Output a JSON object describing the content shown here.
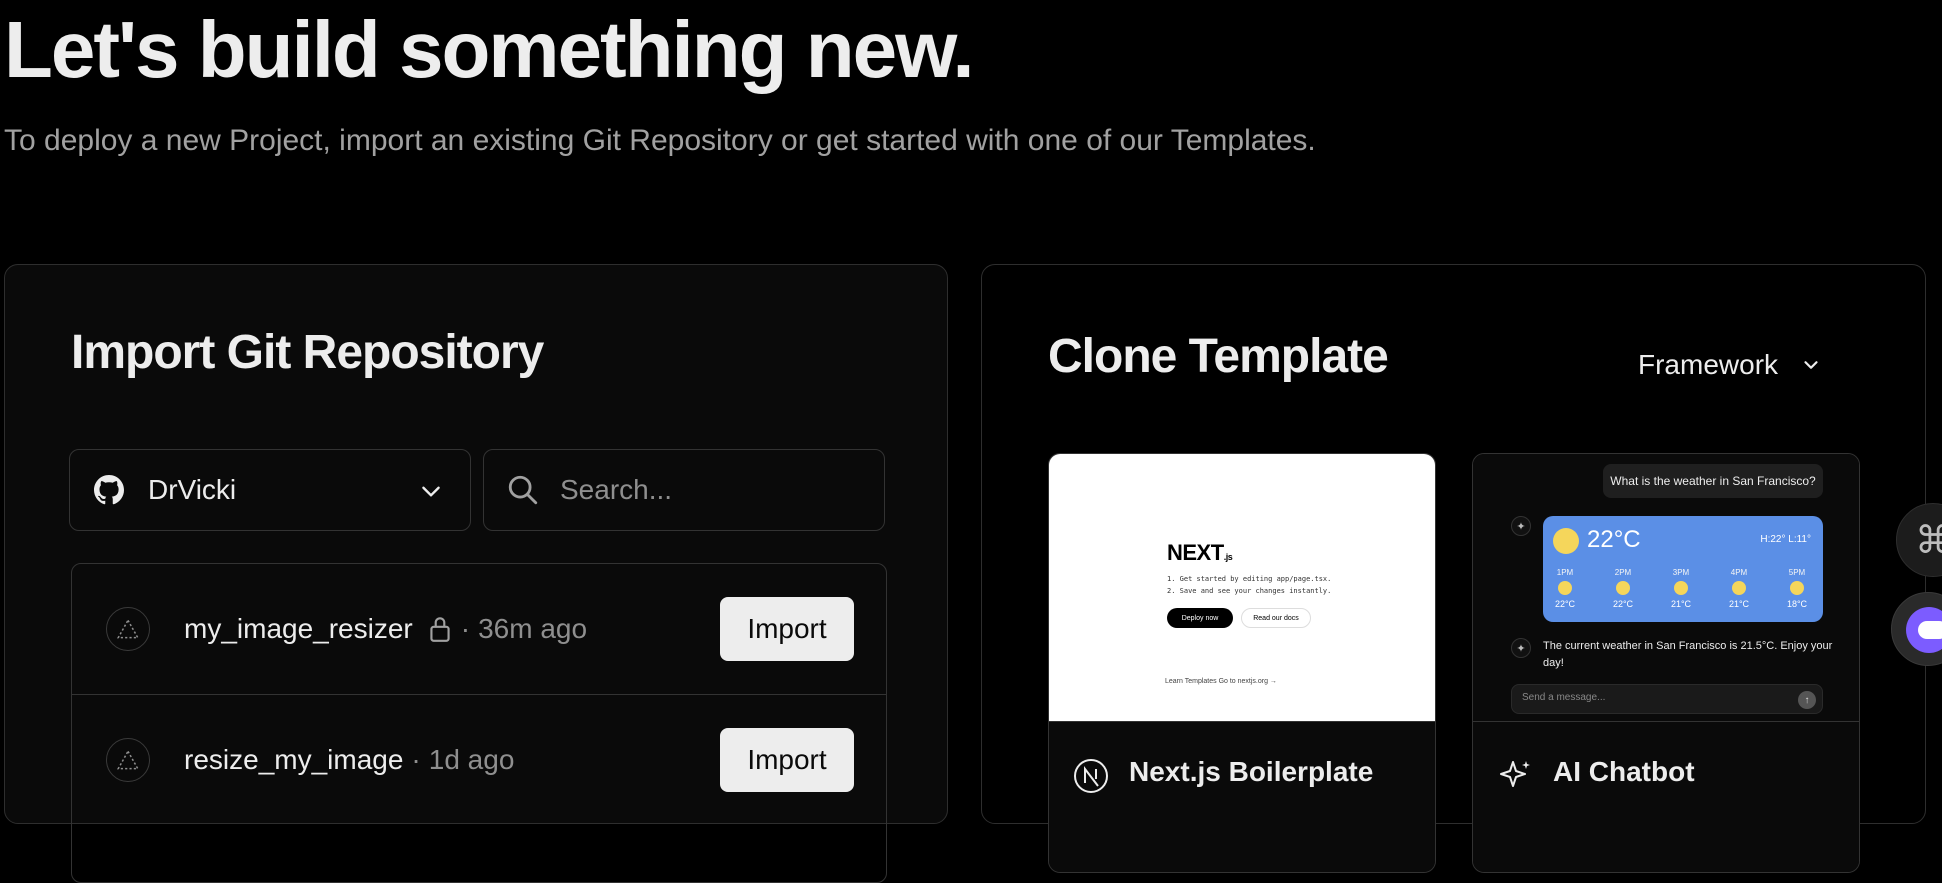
{
  "hero": {
    "title": "Let's build something new.",
    "subtitle": "To deploy a new Project, import an existing Git Repository or get started with one of our Templates."
  },
  "import_panel": {
    "title": "Import Git Repository",
    "scope": "DrVicki",
    "search_placeholder": "Search...",
    "repos": [
      {
        "name": "my_image_resizer",
        "private": true,
        "separator": "·",
        "updated": "36m ago",
        "action": "Import"
      },
      {
        "name": "resize_my_image",
        "private": false,
        "separator": "·",
        "updated": "1d ago",
        "action": "Import"
      }
    ]
  },
  "clone_panel": {
    "title": "Clone Template",
    "filter_label": "Framework",
    "templates": [
      {
        "name": "Next.js Boilerplate",
        "preview": {
          "logo": "NEXT",
          "logo_suffix": ".js",
          "line1": "1. Get started by editing app/page.tsx.",
          "line2": "2. Save and see your changes instantly.",
          "primary": "Deploy now",
          "secondary": "Read our docs",
          "footer": "Learn    Templates    Go to nextjs.org →"
        }
      },
      {
        "name": "AI Chatbot",
        "preview": {
          "question": "What is the weather in San Francisco?",
          "temp": "22°C",
          "hilo": "H:22° L:11°",
          "hours": [
            {
              "h": "1PM",
              "t": "22°C"
            },
            {
              "h": "2PM",
              "t": "22°C"
            },
            {
              "h": "3PM",
              "t": "21°C"
            },
            {
              "h": "4PM",
              "t": "21°C"
            },
            {
              "h": "5PM",
              "t": "18°C"
            }
          ],
          "answer": "The current weather in San Francisco is 21.5°C. Enjoy your day!",
          "input_placeholder": "Send a message..."
        }
      }
    ]
  },
  "colors": {
    "background": "#000000",
    "panel": "#0a0a0a",
    "border": "#333333",
    "text": "#ededed",
    "muted": "#a1a1a1",
    "button": "#ededed",
    "weather_card": "#5b8fe6",
    "sun": "#f5d65b"
  },
  "icons": [
    "github-icon",
    "chevron-down-icon",
    "search-icon",
    "lock-icon",
    "nextjs-icon",
    "sparkles-icon",
    "command-icon",
    "assistant-icon"
  ]
}
